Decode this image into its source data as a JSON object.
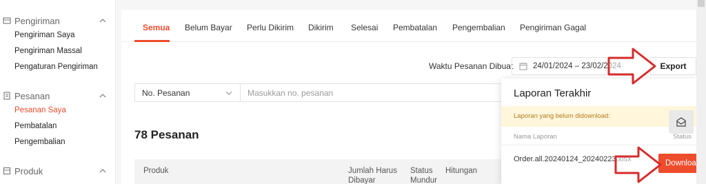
{
  "sidebar": {
    "sections": [
      {
        "title": "Pengiriman",
        "icon": "shipping-icon",
        "items": [
          {
            "label": "Pengiriman Saya",
            "active": false
          },
          {
            "label": "Pengiriman Massal",
            "active": false
          },
          {
            "label": "Pengaturan Pengiriman",
            "active": false
          }
        ]
      },
      {
        "title": "Pesanan",
        "icon": "order-icon",
        "items": [
          {
            "label": "Pesanan Saya",
            "active": true
          },
          {
            "label": "Pembatalan",
            "active": false
          },
          {
            "label": "Pengembalian",
            "active": false
          }
        ]
      },
      {
        "title": "Produk",
        "icon": "product-icon",
        "items": []
      }
    ]
  },
  "tabs": [
    "Semua",
    "Belum Bayar",
    "Perlu Dikirim",
    "Dikirim",
    "Selesai",
    "Pembatalan",
    "Pengembalian",
    "Pengiriman Gagal"
  ],
  "active_tab": "Semua",
  "filter": {
    "date_label": "Waktu Pesanan Dibuat",
    "date_range": "24/01/2024 – 23/02/2024",
    "export_label": "Export"
  },
  "search": {
    "field": "No. Pesanan",
    "placeholder": "Masukkan no. pesanan"
  },
  "order_count": "78 Pesanan",
  "table_headers": {
    "product": "Produk",
    "total": "Jumlah Harus Dibayar",
    "status": "Status Mundur",
    "countdown": "Hitungan"
  },
  "report": {
    "title": "Laporan Terakhir",
    "alert": "Laporan yang belum didownload:",
    "col_name": "Nama Laporan",
    "col_status": "Status",
    "file_name": "Order.all.20240124_20240223.xlsx",
    "download_label": "Download"
  },
  "colors": {
    "accent": "#ee4d2d",
    "arrow": "#d62b2b",
    "alert_bg": "#fff6dc"
  }
}
